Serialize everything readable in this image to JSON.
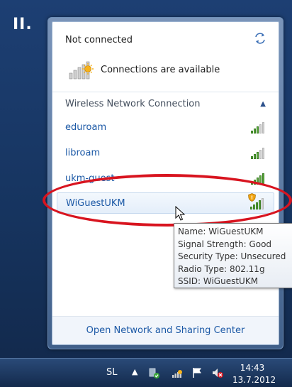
{
  "corner_label": "II.",
  "flyout": {
    "status": "Not connected",
    "availability": "Connections are available",
    "section_title": "Wireless Network Connection",
    "networks": [
      {
        "name": "eduroam",
        "signal_level": 3,
        "signal_max": 5,
        "secured": true
      },
      {
        "name": "libroam",
        "signal_level": 3,
        "signal_max": 5,
        "secured": true
      },
      {
        "name": "ukm-guest",
        "signal_level": 5,
        "signal_max": 5,
        "secured": true
      },
      {
        "name": "WiGuestUKM",
        "signal_level": 4,
        "signal_max": 5,
        "secured": false,
        "warning_icon": "shield-warning-icon"
      }
    ],
    "footer_link": "Open Network and Sharing Center"
  },
  "tooltip": {
    "line1": "Name: WiGuestUKM",
    "line2": "Signal Strength: Good",
    "line3": "Security Type: Unsecured",
    "line4": "Radio Type: 802.11g",
    "line5": "SSID: WiGuestUKM"
  },
  "taskbar": {
    "language": "SL",
    "time": "14:43",
    "date": "13.7.2012",
    "icons": [
      "show-hidden-icons-arrow",
      "safely-remove-hardware-icon",
      "network-icon",
      "action-center-flag-icon",
      "volume-muted-icon"
    ]
  },
  "colors": {
    "link_blue": "#1c59a6",
    "highlight_red": "#d8141f",
    "signal_green": "#5aaa3c"
  }
}
